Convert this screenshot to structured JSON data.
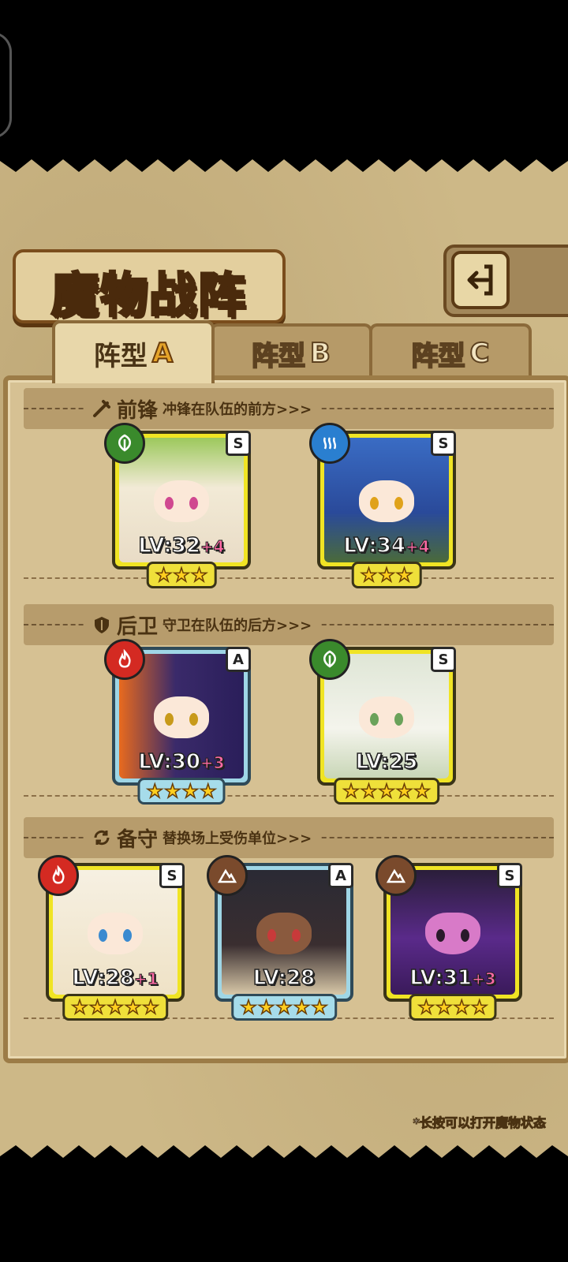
{
  "title": "魔物战阵",
  "back_button": {
    "icon": "return-arrow-icon"
  },
  "tabs": [
    {
      "label": "阵型",
      "suffix": "A",
      "active": true
    },
    {
      "label": "阵型",
      "suffix": "B",
      "active": false
    },
    {
      "label": "阵型",
      "suffix": "C",
      "active": false
    }
  ],
  "sections": {
    "front": {
      "title": "前锋",
      "desc": "冲锋在队伍的前方>>>",
      "icon": "sword-icon"
    },
    "rear": {
      "title": "后卫",
      "desc": "守卫在队伍的后方>>>",
      "icon": "shield-icon"
    },
    "bench": {
      "title": "备守",
      "desc": "替换场上受伤单位>>>",
      "icon": "swap-cycle-icon"
    }
  },
  "cards": {
    "front1": {
      "level": "LV:32",
      "plus": "+4",
      "rank": "S",
      "stars": 3,
      "element": "leaf-icon",
      "element_color": "#3a8a2c",
      "frame": "gold"
    },
    "front2": {
      "level": "LV:34",
      "plus": "+4",
      "rank": "S",
      "stars": 3,
      "element": "water-icon",
      "element_color": "#2a7fd0",
      "frame": "gold"
    },
    "rear1": {
      "level": "LV:30",
      "plus": "+3",
      "rank": "A",
      "stars": 4,
      "element": "fire-icon",
      "element_color": "#d42a22",
      "frame": "blue"
    },
    "rear2": {
      "level": "LV:25",
      "plus": "",
      "rank": "S",
      "stars": 5,
      "element": "leaf-icon",
      "element_color": "#3a8a2c",
      "frame": "gold"
    },
    "bench1": {
      "level": "LV:28",
      "plus": "+1",
      "rank": "S",
      "stars": 5,
      "element": "fire-icon",
      "element_color": "#d42a22",
      "frame": "gold"
    },
    "bench2": {
      "level": "LV:28",
      "plus": "",
      "rank": "A",
      "stars": 5,
      "element": "earth-icon",
      "element_color": "#7a4a2c",
      "frame": "blue"
    },
    "bench3": {
      "level": "LV:31",
      "plus": "+3",
      "rank": "S",
      "stars": 4,
      "element": "earth-icon",
      "element_color": "#7a4a2c",
      "frame": "gold"
    }
  },
  "hint": "*长按可以打开魔物状态"
}
